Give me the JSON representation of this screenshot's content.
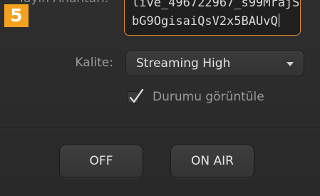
{
  "step": {
    "number": "5",
    "badge_color": "#f4a21e"
  },
  "stream_key": {
    "label_partial": "Yayın Anahtarı:",
    "line1": "live_496722967_s99MrajS",
    "line2": "bG9OgisaiQsV2x5BAUvQ",
    "focus_color": "#e08a2e"
  },
  "quality": {
    "label": "Kalite:",
    "selected": "Streaming High",
    "icon": "chevron-down-icon"
  },
  "status_checkbox": {
    "label": "Durumu görüntüle",
    "checked": true,
    "icon": "checkmark-icon"
  },
  "buttons": {
    "off_label": "OFF",
    "on_air_label": "ON AIR"
  }
}
